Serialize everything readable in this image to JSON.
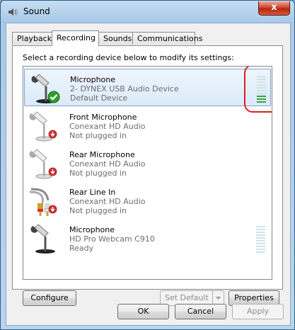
{
  "window": {
    "title": "Sound",
    "close_label": "x"
  },
  "tabs": [
    {
      "label": "Playback"
    },
    {
      "label": "Recording"
    },
    {
      "label": "Sounds"
    },
    {
      "label": "Communications"
    }
  ],
  "instruction": "Select a recording device below to modify its settings:",
  "devices": [
    {
      "name": "Microphone",
      "line2": "2- DYNEX USB Audio Device",
      "line3": "Default Device",
      "icon": "microphone-icon",
      "badge": "green-check-icon",
      "level_fraction": 0.3
    },
    {
      "name": "Front Microphone",
      "line2": "Conexant HD Audio",
      "line3": "Not plugged in",
      "icon": "microphone-icon",
      "badge": "red-down-arrow-icon"
    },
    {
      "name": "Rear Microphone",
      "line2": "Conexant HD Audio",
      "line3": "Not plugged in",
      "icon": "microphone-icon",
      "badge": "red-down-arrow-icon"
    },
    {
      "name": "Rear Line In",
      "line2": "Conexant HD Audio",
      "line3": "Not plugged in",
      "icon": "rca-cable-icon",
      "badge": "red-down-arrow-icon"
    },
    {
      "name": "Microphone",
      "line2": "HD Pro Webcam C910",
      "line3": "Ready",
      "icon": "microphone-icon",
      "level_fraction": 0.0
    }
  ],
  "buttons": {
    "configure": "Configure",
    "set_default": "Set Default",
    "properties": "Properties",
    "ok": "OK",
    "cancel": "Cancel",
    "apply": "Apply"
  },
  "colors": {
    "meter_on": "#3aa23a",
    "meter_off": "#cfe3e8",
    "annotation": "#d9201f"
  }
}
